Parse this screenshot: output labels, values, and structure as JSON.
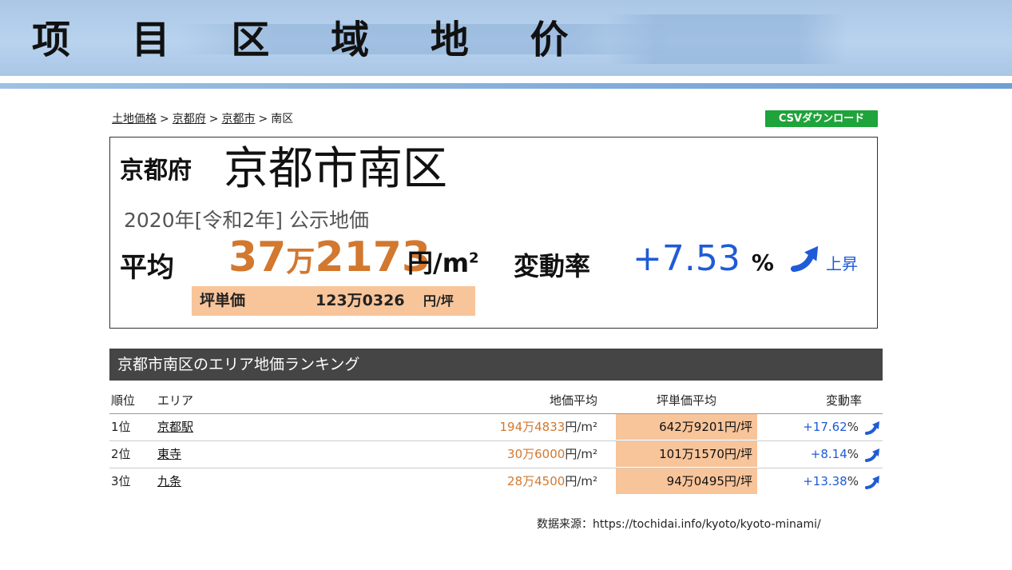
{
  "slide": {
    "title": "项 目 区 域 地 价"
  },
  "breadcrumb": [
    {
      "label": "土地価格",
      "link": true
    },
    {
      "label": "京都府",
      "link": true
    },
    {
      "label": "京都市",
      "link": true
    },
    {
      "label": "南区",
      "link": false
    }
  ],
  "breadcrumb_sep": ">",
  "csv_button": "CSVダウンロード",
  "summary": {
    "prefecture": "京都府",
    "ward": "京都市南区",
    "year_line": "2020年[令和2年] 公示地価",
    "avg_label": "平均",
    "price_man": "37",
    "price_man_unit": "万",
    "price_rest": "2173",
    "price_unit": "円/m",
    "price_unit_sup": "2",
    "rate_label": "変動率",
    "rate_value": "+7.53",
    "rate_pct": "%",
    "rate_trend": "上昇",
    "tsubo_label": "坪単価",
    "tsubo_value": "123万0326",
    "tsubo_unit": "円/坪"
  },
  "ranking": {
    "title": "京都市南区のエリア地価ランキング",
    "headers": {
      "rank": "順位",
      "area": "エリア",
      "price": "地価平均",
      "tsubo": "坪単価平均",
      "rate": "変動率"
    },
    "rows": [
      {
        "rank": "1位",
        "area": "京都駅",
        "price": "194万4833",
        "price_unit": "円/m²",
        "tsubo": "642万9201円/坪",
        "rate": "+17.62",
        "pct": "%"
      },
      {
        "rank": "2位",
        "area": "東寺",
        "price": "30万6000",
        "price_unit": "円/m²",
        "tsubo": "101万1570円/坪",
        "rate": "+8.14",
        "pct": "%"
      },
      {
        "rank": "3位",
        "area": "九条",
        "price": "28万4500",
        "price_unit": "円/m²",
        "tsubo": "94万0495円/坪",
        "rate": "+13.38",
        "pct": "%"
      }
    ]
  },
  "source_note": "数据来源：https://tochidai.info/kyoto/kyoto-minami/",
  "colors": {
    "price_orange": "#d2782f",
    "rate_blue": "#1f5bd6",
    "tsubo_bg": "#f8c49a",
    "csv_green": "#1fa33b",
    "header_blue": "#aac7e6"
  }
}
